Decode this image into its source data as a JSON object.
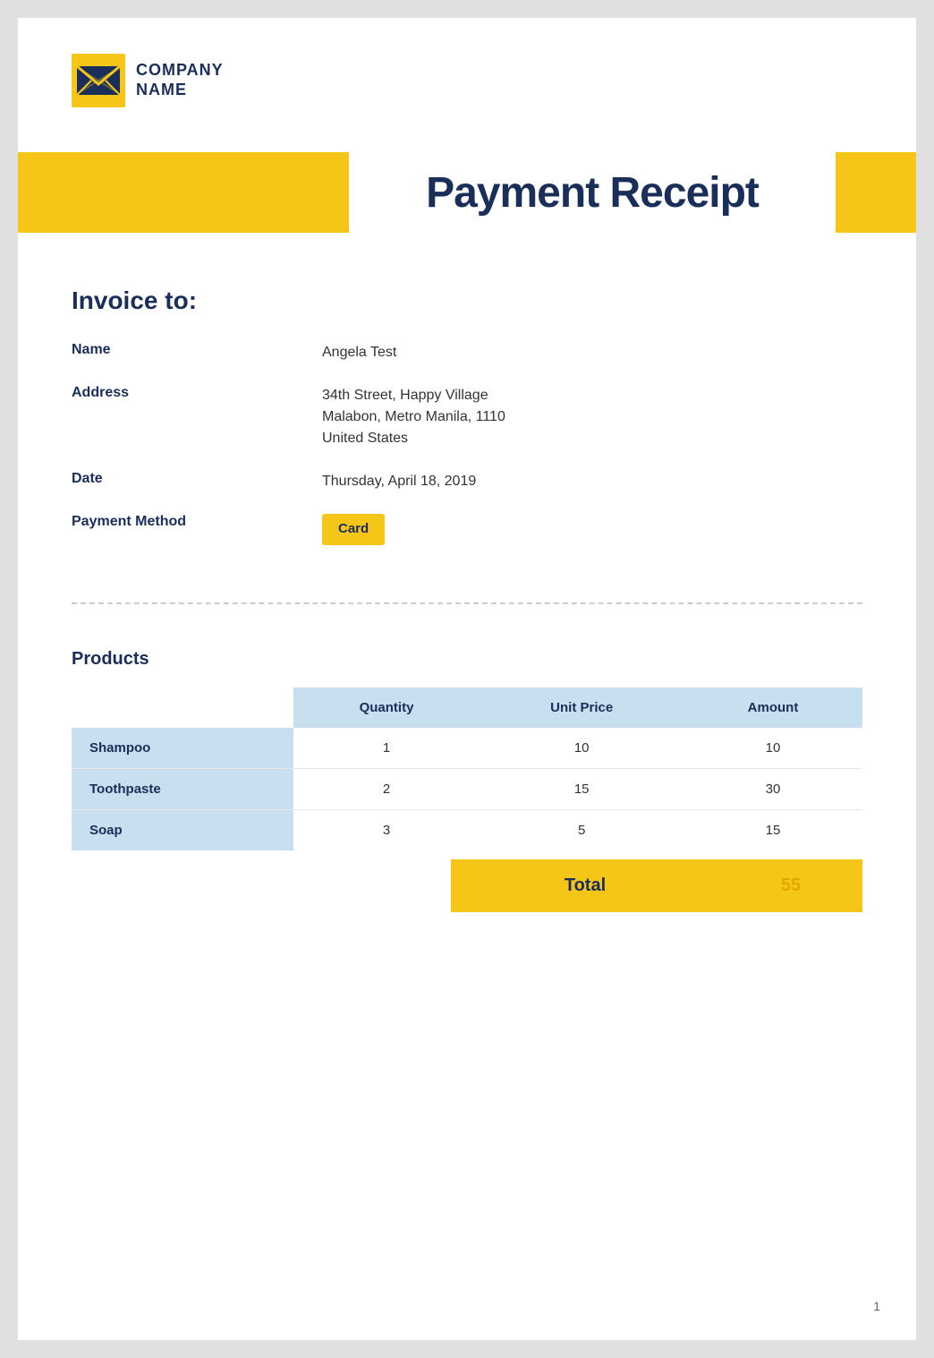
{
  "company": {
    "name_line1": "COMPANY",
    "name_line2": "NAME"
  },
  "page_title": "Payment Receipt",
  "invoice": {
    "heading": "Invoice to:",
    "name_label": "Name",
    "name_value": "Angela Test",
    "address_label": "Address",
    "address_line1": "34th Street, Happy Village",
    "address_line2": "Malabon, Metro Manila, 1110",
    "address_line3": "United States",
    "date_label": "Date",
    "date_value": "Thursday, April 18, 2019",
    "payment_method_label": "Payment Method",
    "payment_method_value": "Card"
  },
  "products": {
    "heading": "Products",
    "table": {
      "headers": [
        "",
        "Quantity",
        "Unit Price",
        "Amount"
      ],
      "rows": [
        {
          "name": "Shampoo",
          "quantity": "1",
          "unit_price": "10",
          "amount": "10"
        },
        {
          "name": "Toothpaste",
          "quantity": "2",
          "unit_price": "15",
          "amount": "30"
        },
        {
          "name": "Soap",
          "quantity": "3",
          "unit_price": "5",
          "amount": "15"
        }
      ]
    },
    "total_label": "Total",
    "total_value": "55"
  },
  "page_number": "1",
  "colors": {
    "yellow": "#f5c518",
    "navy": "#1a2e5a",
    "light_blue": "#c8dff0"
  }
}
